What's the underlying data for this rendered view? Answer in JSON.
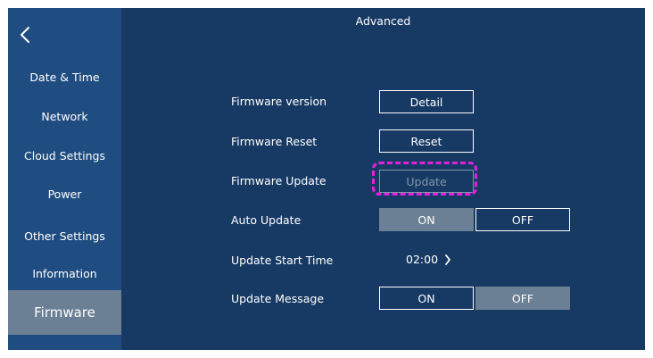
{
  "header": {
    "title": "Advanced"
  },
  "sidebar": {
    "items": [
      {
        "label": "Date & Time",
        "active": false
      },
      {
        "label": "Network",
        "active": false
      },
      {
        "label": "Cloud Settings",
        "active": false
      },
      {
        "label": "Power",
        "active": false
      },
      {
        "label": "Other Settings",
        "active": false
      },
      {
        "label": "Information",
        "active": false
      },
      {
        "label": "Firmware",
        "active": true
      }
    ]
  },
  "settings": {
    "firmware_version": {
      "label": "Firmware version",
      "button": "Detail"
    },
    "firmware_reset": {
      "label": "Firmware Reset",
      "button": "Reset"
    },
    "firmware_update": {
      "label": "Firmware Update",
      "button": "Update",
      "enabled": false
    },
    "auto_update": {
      "label": "Auto Update",
      "on_label": "ON",
      "off_label": "OFF",
      "selected": "ON"
    },
    "update_start_time": {
      "label": "Update Start Time",
      "value": "02:00"
    },
    "update_message": {
      "label": "Update Message",
      "on_label": "ON",
      "off_label": "OFF",
      "selected": "OFF"
    }
  },
  "colors": {
    "background": "#173a65",
    "sidebar": "#204d81",
    "selected": "#6b8095",
    "highlight": "#e61ee0",
    "disabled": "#8196aa"
  }
}
